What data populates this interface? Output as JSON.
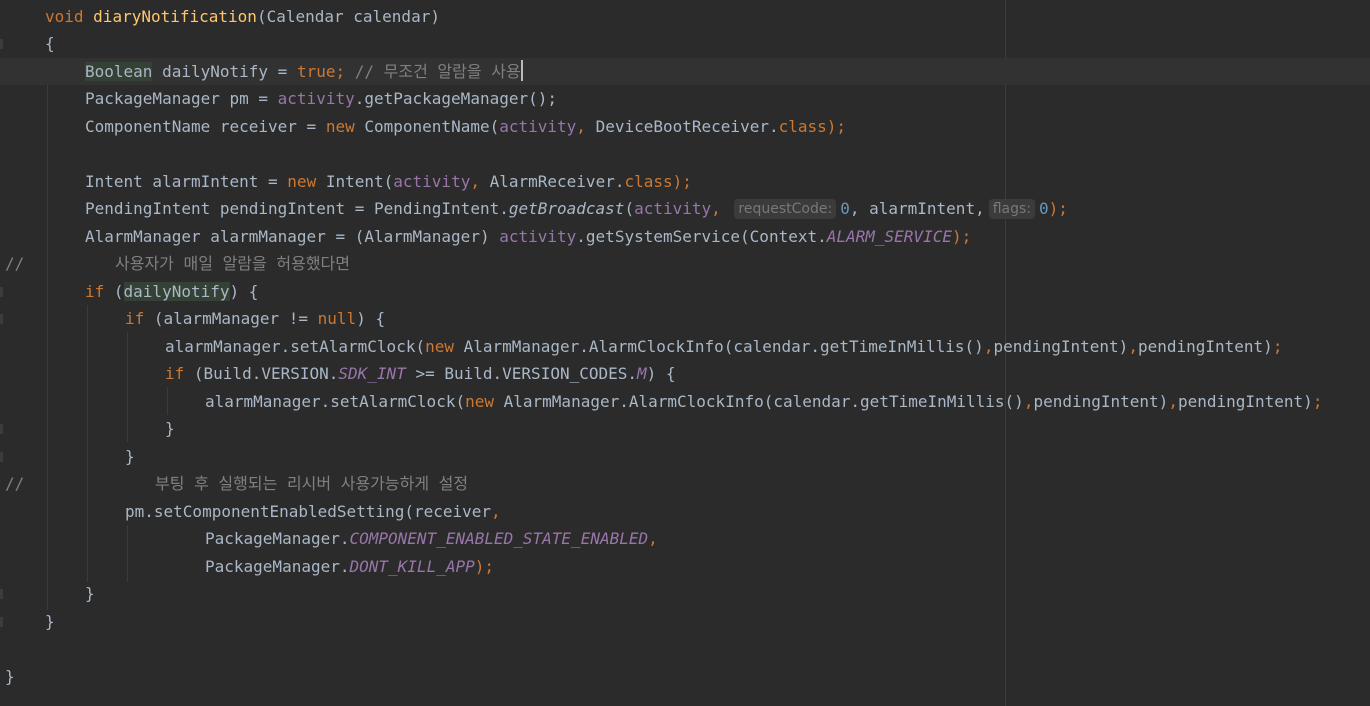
{
  "editor": {
    "theme_colors": {
      "background": "#2b2b2b",
      "keyword": "#cc7832",
      "method_declaration": "#ffc66d",
      "comment": "#808080",
      "field": "#9876aa",
      "number": "#6897bb",
      "plain": "#a9b7c6"
    },
    "line_comment_marker": "//",
    "lines": [
      {
        "a": "void",
        "b": " ",
        "c": "diaryNotification",
        "d": "(Calendar calendar)"
      },
      {
        "a": "{"
      },
      {
        "a": "Boolean",
        "b": " dailyNotify = ",
        "c": "true;",
        "d": " // 무조건 알람을 사용"
      },
      {
        "a": "PackageManager pm = ",
        "b": "activity",
        "c": ".getPackageManager();"
      },
      {
        "a": "ComponentName receiver = ",
        "b": "new",
        "c": " ComponentName(",
        "d": "activity",
        "e": ",",
        "f": " DeviceBootReceiver.",
        "g": "class",
        "h": ");"
      },
      {
        "a": "Intent alarmIntent = ",
        "b": "new",
        "c": " Intent(",
        "d": "activity",
        "e": ",",
        "f": " AlarmReceiver.",
        "g": "class",
        "h": ");"
      },
      {
        "a": "PendingIntent pendingIntent = PendingIntent.",
        "b": "getBroadcast",
        "c": "(",
        "d": "activity",
        "e": ",",
        "hint1": "requestCode:",
        "f": "0",
        "g": ", alarmIntent,",
        "hint2": "flags:",
        "h": "0",
        "i": ");"
      },
      {
        "a": "AlarmManager alarmManager = (AlarmManager) ",
        "b": "activity",
        "c": ".getSystemService(Context.",
        "d": "ALARM_SERVICE",
        "e": ");"
      },
      {
        "a": "사용자가 매일 알람을 허용했다면"
      },
      {
        "a": "if",
        "b": " (",
        "c": "dailyNotify",
        "d": ") {"
      },
      {
        "a": "if",
        "b": " (alarmManager != ",
        "c": "null",
        "d": ") {"
      },
      {
        "a": "alarmManager.setAlarmClock(",
        "b": "new",
        "c": " AlarmManager.AlarmClockInfo(calendar.getTimeInMillis()",
        "d": ",",
        "e": "pendingIntent)",
        "f": ",",
        "g": "pendingIntent)",
        "h": ";"
      },
      {
        "a": "if",
        "b": " (Build.VERSION.",
        "c": "SDK_INT",
        "d": " >= Build.VERSION_CODES.",
        "e": "M",
        "f": ") {"
      },
      {
        "a": "alarmManager.setAlarmClock(",
        "b": "new",
        "c": " AlarmManager.AlarmClockInfo(calendar.getTimeInMillis()",
        "d": ",",
        "e": "pendingIntent)",
        "f": ",",
        "g": "pendingIntent)",
        "h": ";"
      },
      {
        "a": "}"
      },
      {
        "a": "}"
      },
      {
        "a": "부팅 후 실행되는 리시버 사용가능하게 설정"
      },
      {
        "a": "pm.setComponentEnabledSetting(receiver",
        "b": ","
      },
      {
        "a": "PackageManager.",
        "b": "COMPONENT_ENABLED_STATE_ENABLED",
        "c": ","
      },
      {
        "a": "PackageManager.",
        "b": "DONT_KILL_APP",
        "c": ");"
      },
      {
        "a": "}"
      },
      {
        "a": "}"
      },
      {
        "a": "}"
      }
    ]
  }
}
